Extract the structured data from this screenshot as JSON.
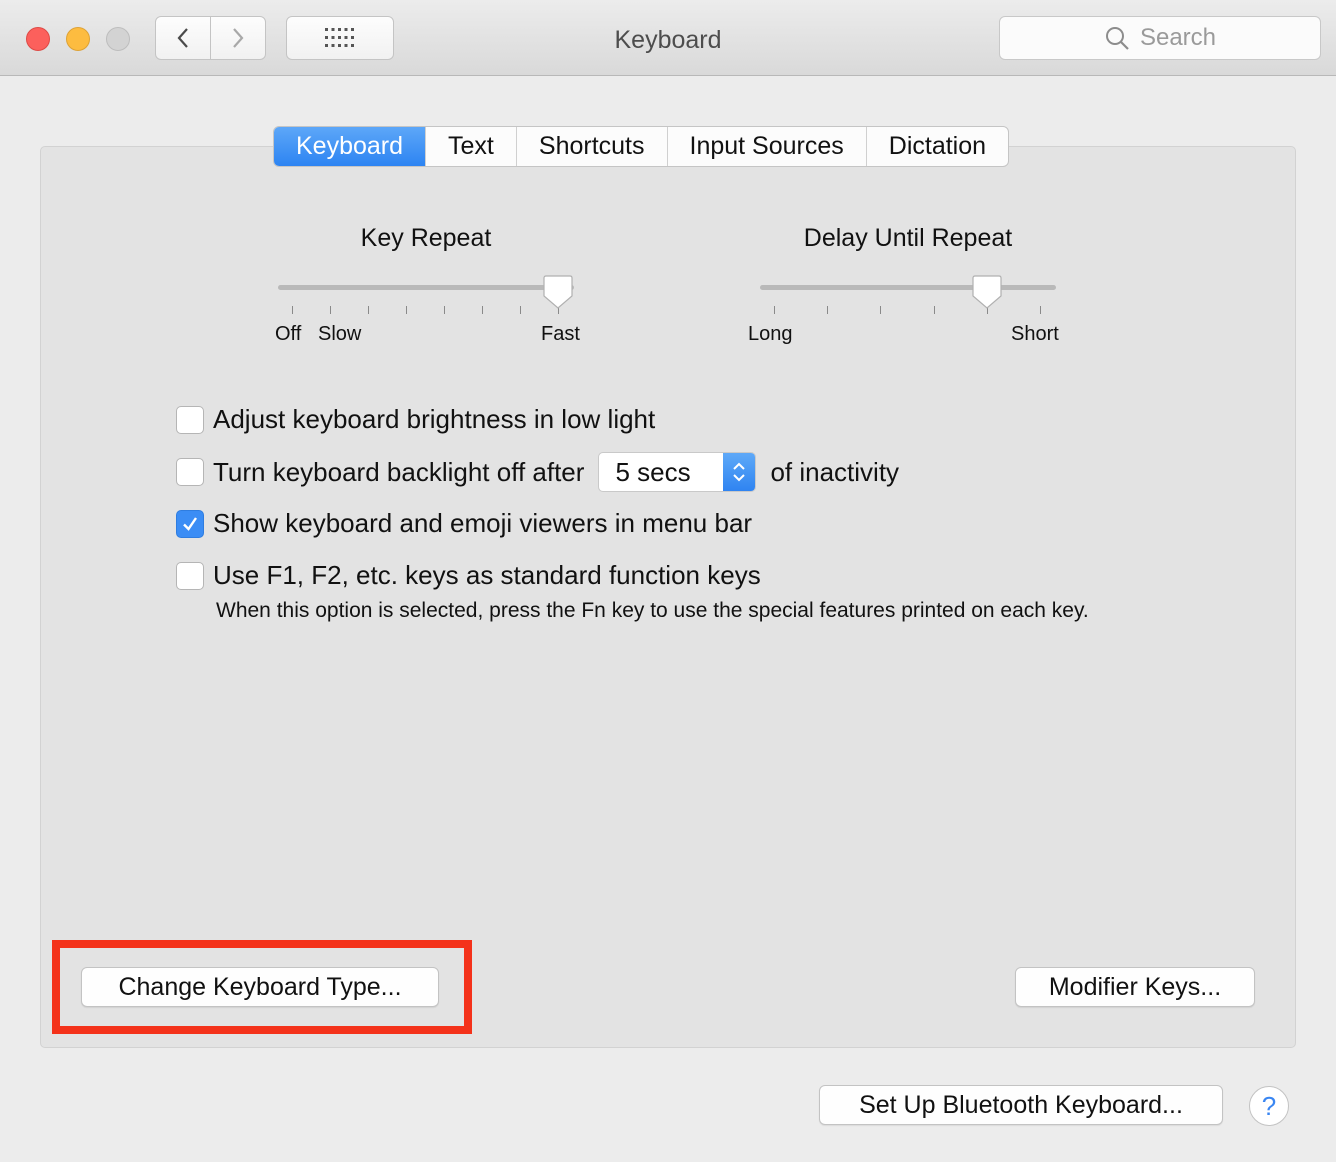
{
  "window": {
    "title": "Keyboard"
  },
  "toolbar": {
    "search_placeholder": "Search"
  },
  "tabs": [
    {
      "label": "Keyboard",
      "active": true
    },
    {
      "label": "Text",
      "active": false
    },
    {
      "label": "Shortcuts",
      "active": false
    },
    {
      "label": "Input Sources",
      "active": false
    },
    {
      "label": "Dictation",
      "active": false
    }
  ],
  "key_repeat": {
    "title": "Key Repeat",
    "labels": {
      "off": "Off",
      "slow": "Slow",
      "fast": "Fast"
    },
    "value": 1.0
  },
  "delay_until_repeat": {
    "title": "Delay Until Repeat",
    "labels": {
      "long": "Long",
      "short": "Short"
    },
    "value": 0.8
  },
  "options": {
    "brightness": {
      "label": "Adjust keyboard brightness in low light",
      "checked": false
    },
    "backlight": {
      "label": "Turn keyboard backlight off after",
      "value": "5 secs",
      "suffix": "of inactivity",
      "checked": false
    },
    "viewers": {
      "label": "Show keyboard and emoji viewers in menu bar",
      "checked": true
    },
    "fn_keys": {
      "label": "Use F1, F2, etc. keys as standard function keys",
      "checked": false,
      "hint": "When this option is selected, press the Fn key to use the special features printed on each key."
    }
  },
  "buttons": {
    "change_keyboard_type": "Change Keyboard Type...",
    "modifier_keys": "Modifier Keys...",
    "bluetooth": "Set Up Bluetooth Keyboard...",
    "help": "?"
  },
  "colors": {
    "accent": "#3b8df5",
    "highlight": "#f4321a"
  }
}
